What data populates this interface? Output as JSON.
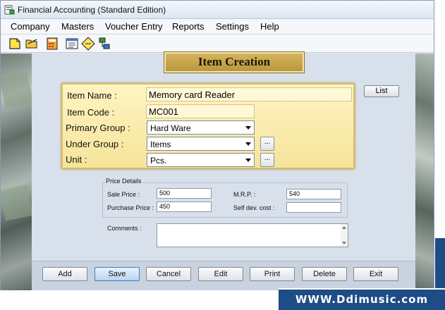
{
  "window": {
    "title": "Financial Accounting (Standard Edition)"
  },
  "menu": [
    "Company",
    "Masters",
    "Voucher Entry",
    "Reports",
    "Settings",
    "Help"
  ],
  "toolbar": {
    "icons": [
      "new-document-icon",
      "open-folder-icon",
      "calculator-icon",
      "calendar-icon",
      "diamond-note-icon",
      "network-icon"
    ]
  },
  "form": {
    "title": "Item Creation",
    "list_label": "List",
    "fields": {
      "item_name": {
        "label": "Item Name :",
        "value": "Memory card Reader"
      },
      "item_code": {
        "label": "Item Code :",
        "value": "MC001"
      },
      "primary_group": {
        "label": "Primary Group :",
        "value": "Hard Ware"
      },
      "under_group": {
        "label": "Under Group :",
        "value": "Items"
      },
      "unit": {
        "label": "Unit :",
        "value": "Pcs."
      }
    },
    "ellipsis": "...",
    "price_details": {
      "title": "Price Details",
      "sale_price": {
        "label": "Sale Price :",
        "value": "500"
      },
      "purchase_price": {
        "label": "Purchase Price :",
        "value": "450"
      },
      "mrp": {
        "label": "M.R.P. :",
        "value": "540"
      },
      "self_dev_cost": {
        "label": "Self dev. cost :",
        "value": ""
      }
    },
    "comments": {
      "label": "Comments :",
      "value": ""
    }
  },
  "buttons": {
    "add": "Add",
    "save": "Save",
    "cancel": "Cancel",
    "edit": "Edit",
    "print": "Print",
    "delete": "Delete",
    "exit": "Exit"
  },
  "watermark": "WWW.Ddimusic.com",
  "colors": {
    "banner": "#c8a84e",
    "panel": "#fbedb0",
    "background": "#d8e0ec",
    "watermark": "#1d4c86",
    "primary_button_border": "#3d7fc1"
  }
}
